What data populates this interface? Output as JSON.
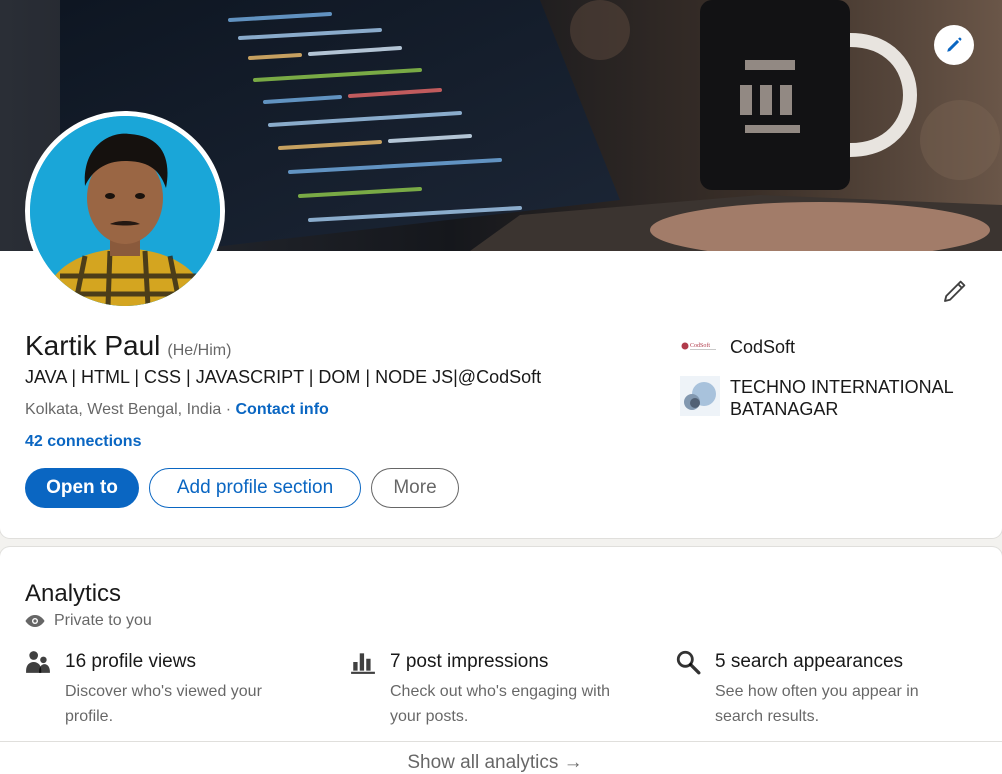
{
  "profile": {
    "name": "Kartik Paul",
    "pronouns": "(He/Him)",
    "headline": "JAVA | HTML | CSS | JAVASCRIPT | DOM | NODE JS|@CodSoft",
    "location": "Kolkata, West Bengal, India",
    "location_separator": " · ",
    "contact_info_label": "Contact info",
    "connections_label": "42 connections",
    "buttons": {
      "open_to": "Open to",
      "add_profile_section": "Add profile section",
      "more": "More"
    },
    "organizations": [
      {
        "name": "CodSoft",
        "logo_text": "CodSoft",
        "icon": "codsoft-logo"
      },
      {
        "name": "TECHNO INTERNATIONAL BATANAGAR",
        "icon": "techno-logo"
      }
    ],
    "icons": {
      "banner_edit": "pencil-icon",
      "intro_edit": "pencil-outline-icon"
    }
  },
  "analytics": {
    "title": "Analytics",
    "privacy_label": "Private to you",
    "stats": [
      {
        "title": "16 profile views",
        "description": "Discover who's viewed your profile.",
        "icon": "people-icon"
      },
      {
        "title": "7 post impressions",
        "description": "Check out who's engaging with your posts.",
        "icon": "bar-chart-icon"
      },
      {
        "title": "5 search appearances",
        "description": "See how often you appear in search results.",
        "icon": "search-icon"
      }
    ],
    "show_all_label": "Show all analytics",
    "show_all_arrow": "→"
  },
  "colors": {
    "brand_blue": "#0a66c2",
    "page_background": "#f3f2ef",
    "card_background": "#ffffff"
  }
}
